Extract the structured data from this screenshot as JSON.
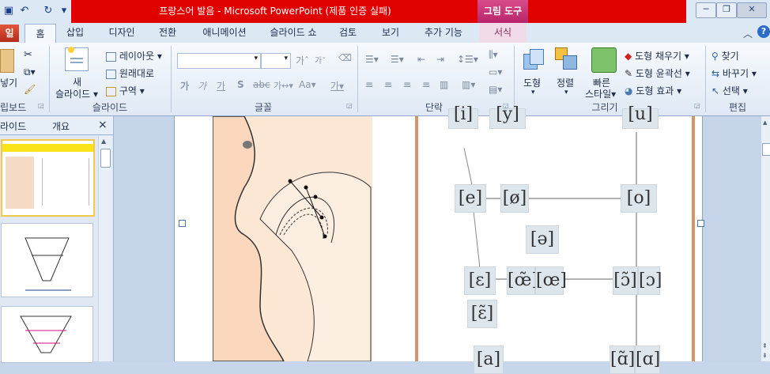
{
  "window": {
    "title": "프랑스어 발음 - Microsoft PowerPoint (제품 인증 실패)",
    "context_tool": "그림 도구"
  },
  "tabs": [
    "일",
    "홈",
    "삽입",
    "디자인",
    "전환",
    "애니메이션",
    "슬라이드 쇼",
    "검토",
    "보기",
    "추가 기능",
    "서식"
  ],
  "ribbon": {
    "clipboard": {
      "paste_label": "넣기",
      "group_label": "립보드"
    },
    "slides": {
      "new_slide_line1": "새",
      "new_slide_line2": "슬라이드",
      "layout": "레이아웃",
      "reset": "원래대로",
      "section": "구역",
      "group_label": "슬라이드"
    },
    "font": {
      "group_label": "글꼴"
    },
    "paragraph": {
      "group_label": "단락"
    },
    "drawing": {
      "shape": "도형",
      "arrange": "정렬",
      "quick_styles_line1": "빠른",
      "quick_styles_line2": "스타일",
      "fill": "도형 채우기",
      "outline": "도형 윤곽선",
      "effects": "도형 효과",
      "group_label": "그리기"
    },
    "editing": {
      "find": "찾기",
      "replace": "바꾸기",
      "select": "선택",
      "group_label": "편집"
    }
  },
  "pane": {
    "tab_slides": "라이드",
    "tab_outline": "개요",
    "close": "×"
  },
  "slide": {
    "vowels": [
      "[i]",
      "[y]",
      "[u]",
      "[e]",
      "[ø]",
      "[o]",
      "[ə]",
      "[ɛ]",
      "[œ̃]",
      "[œ]",
      "[ɔ̃]",
      "[ɔ]",
      "[ɛ̃]",
      "[a]",
      "[ɑ̃]",
      "[ɑ]"
    ]
  },
  "colors": {
    "title_red": "#e00000",
    "context_pink": "#c2185b",
    "ribbon_bg": "#dfe9f5",
    "slide_border": "#d4956a"
  }
}
